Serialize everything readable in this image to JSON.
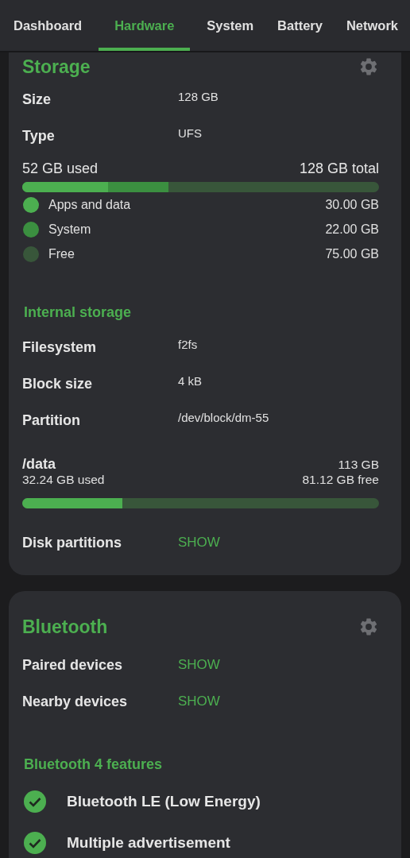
{
  "tabs": [
    {
      "label": "Dashboard",
      "selected": false
    },
    {
      "label": "Hardware",
      "selected": true
    },
    {
      "label": "System",
      "selected": false
    },
    {
      "label": "Battery",
      "selected": false
    },
    {
      "label": "Network",
      "selected": false
    }
  ],
  "storage": {
    "title": "Storage",
    "properties": [
      {
        "label": "Size",
        "value": "128 GB"
      },
      {
        "label": "Type",
        "value": "UFS"
      }
    ],
    "usage": {
      "used": "52 GB used",
      "total": "128 GB total",
      "level": 0.41,
      "segments": [
        {
          "name": "Apps and data",
          "value": "30.00 GB",
          "color": "#4caf50",
          "level": 0.24
        },
        {
          "name": "System",
          "value": "22.00 GB",
          "color": "#3b8f40"
        },
        {
          "name": "Free",
          "value": "75.00 GB",
          "color": "#38563a"
        }
      ]
    },
    "internal": {
      "title": "Internal storage",
      "properties": [
        {
          "label": "Filesystem",
          "value": "f2fs"
        },
        {
          "label": "Block size",
          "value": "4 kB"
        },
        {
          "label": "Partition",
          "value": "/dev/block/dm-55"
        }
      ],
      "mount": {
        "path": "/data",
        "size": "113 GB",
        "used": "32.24 GB used",
        "free": "81.12 GB free",
        "level": 0.28
      }
    },
    "links": [
      {
        "label": "Disk partitions",
        "action": "SHOW"
      }
    ]
  },
  "bluetooth": {
    "title": "Bluetooth",
    "links": [
      {
        "label": "Paired devices",
        "action": "SHOW"
      },
      {
        "label": "Nearby devices",
        "action": "SHOW"
      }
    ],
    "features_title": "Bluetooth 4 features",
    "features": [
      {
        "label": "Bluetooth LE (Low Energy)",
        "checked": true
      },
      {
        "label": "Multiple advertisement",
        "checked": true
      }
    ]
  }
}
